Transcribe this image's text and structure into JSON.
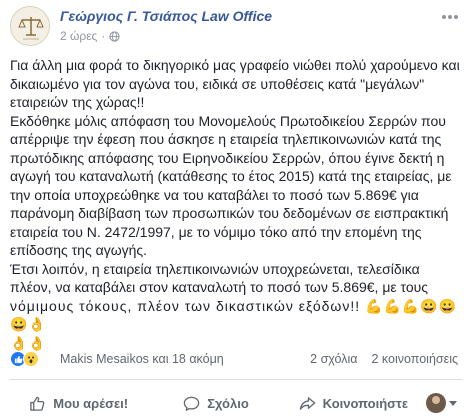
{
  "header": {
    "page_name": "Γεώργιος Γ. Τσιάπος Law Office",
    "time": "2 ώρες",
    "time_separator": "·",
    "privacy_icon": "globe-icon",
    "more_icon": "more-options-icon"
  },
  "post": {
    "lines": [
      "Για άλλη μια φορά το δικηγορικό μας γραφείο νιώθει πολύ χαρούμενο και",
      "δικαιωμένο για τον αγώνα του, ειδικά σε υποθέσεις κατά \"μεγάλων\"",
      "εταιρειών της χώρας!!",
      "Εκδόθηκε μόλις απόφαση του Μονομελούς Πρωτοδικείου Σερρών που",
      "απέρριψε την έφεση που άσκησε η εταιρεία τηλεπικοινωνιών κατά της",
      "πρωτόδικης απόφασης του Ειρηνοδικείου Σερρών, όπου έγινε δεκτή η",
      "αγωγή του καταναλωτή (κατάθεσης το έτος 2015) κατά της εταιρείας, με",
      "την οποία υποχρεώθηκε να του καταβάλει το ποσό των 5.869€ για",
      "παράνομη διαβίβαση των προσωπικών του δεδομένων σε εισπρακτική",
      "εταιρεία του Ν. 2472/1997, με το νόμιμο τόκο από την επομένη της",
      "επίδοσης της αγωγής.",
      "Έτσι λοιπόν, η εταιρεία τηλεπικοινωνιών υποχρεώνεται, τελεσίδικα",
      "πλέον, να καταβάλει στον καταναλωτή το ποσό των 5.869€, με τους",
      "νόμιμους τόκους, πλέον των δικαστικών εξόδων!! 💪💪💪😀😀😀👌",
      "👌👌"
    ]
  },
  "reactions": {
    "icons": [
      "like-icon",
      "wow-icon"
    ],
    "names": "Makis Mesaikos και 18 ακόμη",
    "comments": "2 σχόλια",
    "shares": "2 κοινοποιήσεις"
  },
  "actions": {
    "like_label": "Μου αρέσει!",
    "comment_label": "Σχόλιο",
    "share_label": "Κοινοποιήστε"
  },
  "colors": {
    "link": "#365899",
    "meta": "#90949c",
    "like_blue": "#2078f4",
    "wow_yellow": "#fcd24c",
    "action_gray": "#606770"
  }
}
